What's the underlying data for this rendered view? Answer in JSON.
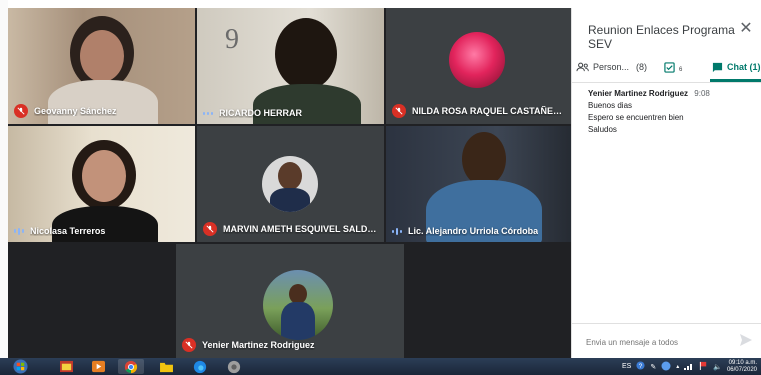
{
  "participants": [
    {
      "name": "Geovanny Sánchez",
      "mic": "muted"
    },
    {
      "name": "RICARDO HERRAR",
      "mic": "active"
    },
    {
      "name": "NILDA ROSA RAQUEL CASTAÑEDA DE S...",
      "mic": "muted"
    },
    {
      "name": "Nicolasa Terreros",
      "mic": "speaking"
    },
    {
      "name": "MARVIN AMETH ESQUIVEL SALDAÑA",
      "mic": "muted"
    },
    {
      "name": "Lic. Alejandro Urriola Córdoba",
      "mic": "speaking"
    },
    {
      "name": "Yenier Martinez Rodriguez",
      "mic": "muted"
    }
  ],
  "panel": {
    "title": "Reunion Enlaces Programa SEV",
    "close_icon": "close-icon",
    "tabs": {
      "people": {
        "label": "Person...",
        "count": "(8)"
      },
      "tasks": {
        "count": "6"
      },
      "chat": {
        "label": "Chat (1)"
      }
    },
    "message": {
      "sender": "Yenier Martinez Rodriguez",
      "time": "9:08",
      "lines": [
        "Buenos dias",
        "Espero se encuentren  bien",
        "Saludos"
      ]
    },
    "compose_placeholder": "Envia un mensaje a todos"
  },
  "taskbar": {
    "language": "ES",
    "clock_time": "09:10 a.m.",
    "clock_date": "06/07/2020"
  },
  "colors": {
    "accent": "#00796b",
    "muted_red": "#d93025",
    "tile_bg": "#202124"
  }
}
